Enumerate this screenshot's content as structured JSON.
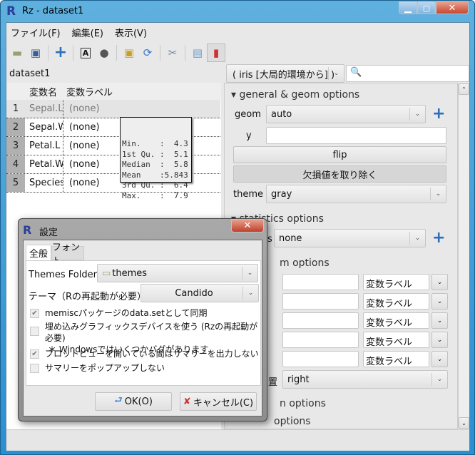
{
  "window": {
    "title": "Rz - dataset1",
    "app_icon": "R"
  },
  "menu": [
    "ファイル(F)",
    "編集(E)",
    "表示(V)"
  ],
  "toolbar": [
    "open-folder-icon",
    "save-icon",
    "add-icon",
    "text-A-icon",
    "trash-icon",
    "import-icon",
    "refresh-icon",
    "tools-icon",
    "table-view-icon",
    "chart-view-icon"
  ],
  "dataset": {
    "name": "dataset1",
    "source": "( iris [大局的環境から] )",
    "search_placeholder": ""
  },
  "table": {
    "headers": [
      "変数名",
      "変数ラベル"
    ],
    "rows": [
      {
        "n": "1",
        "name": "Sepal.L",
        "label": "(none)"
      },
      {
        "n": "2",
        "name": "Sepal.W",
        "label": "(none)"
      },
      {
        "n": "3",
        "name": "Petal.L",
        "label": "(none)"
      },
      {
        "n": "4",
        "name": "Petal.W",
        "label": "(none)"
      },
      {
        "n": "5",
        "name": "Species",
        "label": "(none)"
      }
    ]
  },
  "summary": [
    "Min.    :  4.3",
    "1st Qu. :  5.1",
    "Median  :  5.8",
    "Mean    :5.843",
    "3rd Qu. :  6.4",
    "Max.    :  7.9"
  ],
  "panel": {
    "general_title": "general & geom options",
    "geom_label": "geom",
    "geom_value": "auto",
    "y_label": "y",
    "flip": "flip",
    "remove_na": "欠損値を取り除く",
    "theme_label": "theme",
    "theme_value": "gray",
    "stats_title": "statistics options",
    "stats_label_partial": "s",
    "stats_value": "none",
    "section3_partial": "m options",
    "label_select": "変数ラベル",
    "position_label_partial": "置",
    "position_value": "right",
    "section4_partial": "n options",
    "section5_partial": "options"
  },
  "dialog": {
    "title": "設定",
    "tabs": [
      "全般",
      "フォント"
    ],
    "themes_folder_label": "Themes Folder",
    "themes_folder_value": "themes",
    "theme_label": "テーマ（Rの再起動が必要）",
    "theme_value": "Candido",
    "options": [
      {
        "label": "memiscパッケージのdata.setとして同期",
        "checked": true
      },
      {
        "label": "埋め込みグラフィックスデバイスを使う (Rzの再起動が必要)",
        "note": "＊ Windowsではいくつかバグがあります",
        "checked": false
      },
      {
        "label": "プロットビューを開いている間はサマリーを出力しない",
        "checked": true
      },
      {
        "label": "サマリーをポップアップしない",
        "checked": false
      }
    ],
    "ok": "OK(O)",
    "cancel": "キャンセル(C)"
  }
}
